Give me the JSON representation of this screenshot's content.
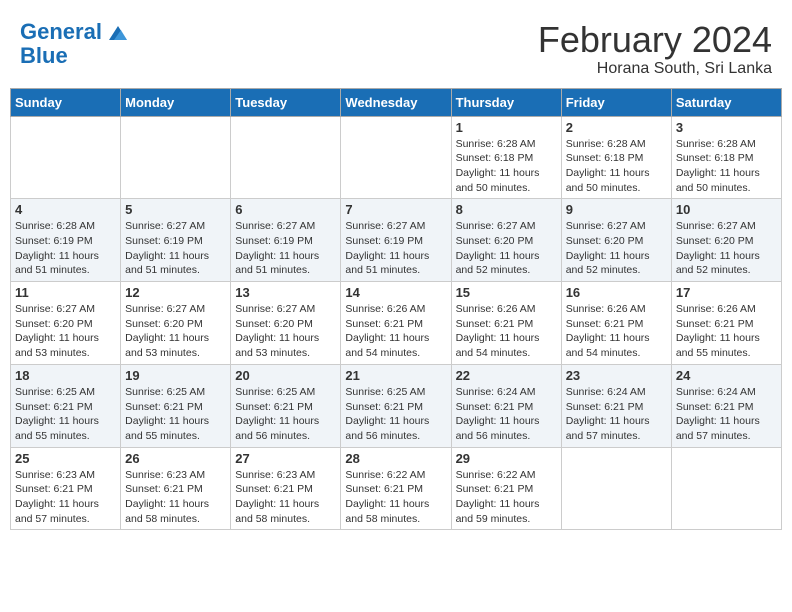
{
  "header": {
    "logo_line1": "General",
    "logo_line2": "Blue",
    "month_year": "February 2024",
    "location": "Horana South, Sri Lanka"
  },
  "weekdays": [
    "Sunday",
    "Monday",
    "Tuesday",
    "Wednesday",
    "Thursday",
    "Friday",
    "Saturday"
  ],
  "weeks": [
    [
      {
        "day": "",
        "info": ""
      },
      {
        "day": "",
        "info": ""
      },
      {
        "day": "",
        "info": ""
      },
      {
        "day": "",
        "info": ""
      },
      {
        "day": "1",
        "info": "Sunrise: 6:28 AM\nSunset: 6:18 PM\nDaylight: 11 hours and 50 minutes."
      },
      {
        "day": "2",
        "info": "Sunrise: 6:28 AM\nSunset: 6:18 PM\nDaylight: 11 hours and 50 minutes."
      },
      {
        "day": "3",
        "info": "Sunrise: 6:28 AM\nSunset: 6:18 PM\nDaylight: 11 hours and 50 minutes."
      }
    ],
    [
      {
        "day": "4",
        "info": "Sunrise: 6:28 AM\nSunset: 6:19 PM\nDaylight: 11 hours and 51 minutes."
      },
      {
        "day": "5",
        "info": "Sunrise: 6:27 AM\nSunset: 6:19 PM\nDaylight: 11 hours and 51 minutes."
      },
      {
        "day": "6",
        "info": "Sunrise: 6:27 AM\nSunset: 6:19 PM\nDaylight: 11 hours and 51 minutes."
      },
      {
        "day": "7",
        "info": "Sunrise: 6:27 AM\nSunset: 6:19 PM\nDaylight: 11 hours and 51 minutes."
      },
      {
        "day": "8",
        "info": "Sunrise: 6:27 AM\nSunset: 6:20 PM\nDaylight: 11 hours and 52 minutes."
      },
      {
        "day": "9",
        "info": "Sunrise: 6:27 AM\nSunset: 6:20 PM\nDaylight: 11 hours and 52 minutes."
      },
      {
        "day": "10",
        "info": "Sunrise: 6:27 AM\nSunset: 6:20 PM\nDaylight: 11 hours and 52 minutes."
      }
    ],
    [
      {
        "day": "11",
        "info": "Sunrise: 6:27 AM\nSunset: 6:20 PM\nDaylight: 11 hours and 53 minutes."
      },
      {
        "day": "12",
        "info": "Sunrise: 6:27 AM\nSunset: 6:20 PM\nDaylight: 11 hours and 53 minutes."
      },
      {
        "day": "13",
        "info": "Sunrise: 6:27 AM\nSunset: 6:20 PM\nDaylight: 11 hours and 53 minutes."
      },
      {
        "day": "14",
        "info": "Sunrise: 6:26 AM\nSunset: 6:21 PM\nDaylight: 11 hours and 54 minutes."
      },
      {
        "day": "15",
        "info": "Sunrise: 6:26 AM\nSunset: 6:21 PM\nDaylight: 11 hours and 54 minutes."
      },
      {
        "day": "16",
        "info": "Sunrise: 6:26 AM\nSunset: 6:21 PM\nDaylight: 11 hours and 54 minutes."
      },
      {
        "day": "17",
        "info": "Sunrise: 6:26 AM\nSunset: 6:21 PM\nDaylight: 11 hours and 55 minutes."
      }
    ],
    [
      {
        "day": "18",
        "info": "Sunrise: 6:25 AM\nSunset: 6:21 PM\nDaylight: 11 hours and 55 minutes."
      },
      {
        "day": "19",
        "info": "Sunrise: 6:25 AM\nSunset: 6:21 PM\nDaylight: 11 hours and 55 minutes."
      },
      {
        "day": "20",
        "info": "Sunrise: 6:25 AM\nSunset: 6:21 PM\nDaylight: 11 hours and 56 minutes."
      },
      {
        "day": "21",
        "info": "Sunrise: 6:25 AM\nSunset: 6:21 PM\nDaylight: 11 hours and 56 minutes."
      },
      {
        "day": "22",
        "info": "Sunrise: 6:24 AM\nSunset: 6:21 PM\nDaylight: 11 hours and 56 minutes."
      },
      {
        "day": "23",
        "info": "Sunrise: 6:24 AM\nSunset: 6:21 PM\nDaylight: 11 hours and 57 minutes."
      },
      {
        "day": "24",
        "info": "Sunrise: 6:24 AM\nSunset: 6:21 PM\nDaylight: 11 hours and 57 minutes."
      }
    ],
    [
      {
        "day": "25",
        "info": "Sunrise: 6:23 AM\nSunset: 6:21 PM\nDaylight: 11 hours and 57 minutes."
      },
      {
        "day": "26",
        "info": "Sunrise: 6:23 AM\nSunset: 6:21 PM\nDaylight: 11 hours and 58 minutes."
      },
      {
        "day": "27",
        "info": "Sunrise: 6:23 AM\nSunset: 6:21 PM\nDaylight: 11 hours and 58 minutes."
      },
      {
        "day": "28",
        "info": "Sunrise: 6:22 AM\nSunset: 6:21 PM\nDaylight: 11 hours and 58 minutes."
      },
      {
        "day": "29",
        "info": "Sunrise: 6:22 AM\nSunset: 6:21 PM\nDaylight: 11 hours and 59 minutes."
      },
      {
        "day": "",
        "info": ""
      },
      {
        "day": "",
        "info": ""
      }
    ]
  ]
}
